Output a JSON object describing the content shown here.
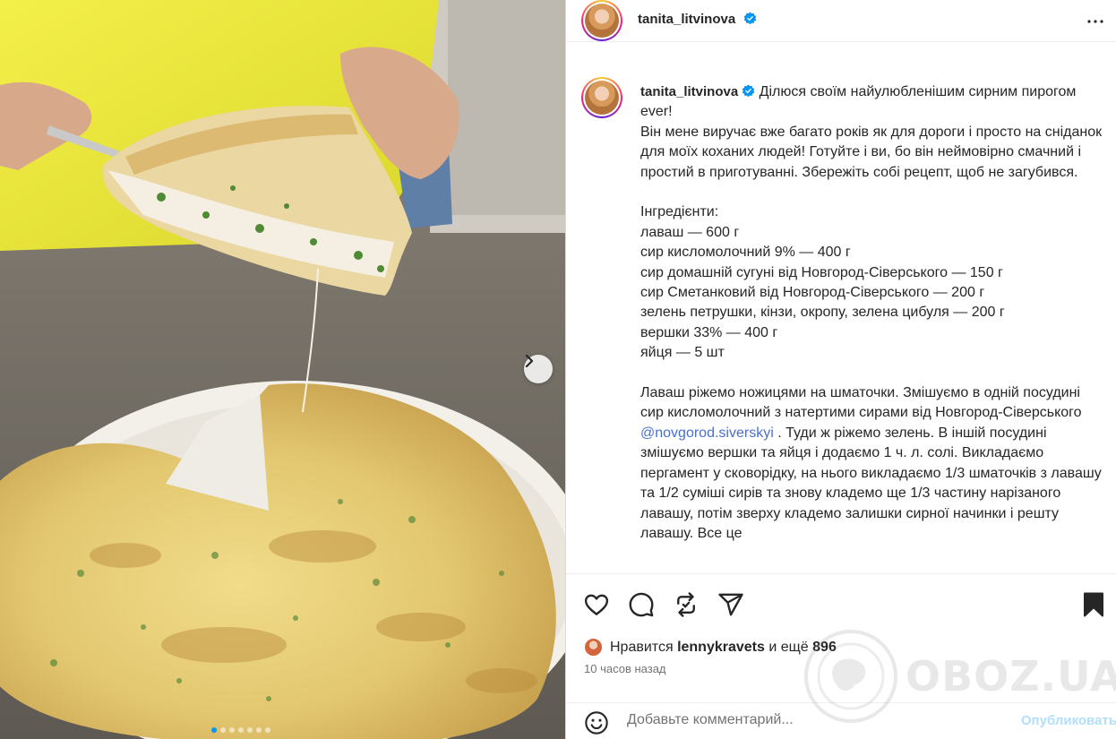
{
  "post": {
    "username": "tanita_litvinova",
    "caption": {
      "intro": "Ділюся своїм найулюбленішим сирним пирогом ever!",
      "paragraph1": "Він мене виручає вже багато років як для дороги і просто на сніданок для моїх коханих людей! Готуйте і ви, бо він неймовірно смачний і простий в приготуванні. Збережіть собі рецепт, щоб не загубився.",
      "ingredients_title": "Інгредієнти:",
      "ingredients": [
        "лаваш — 600 г",
        "сир кисломолочний 9% — 400 г",
        "сир домашній сугуні від Новгород-Сіверського — 150 г",
        "сир Сметанковий від Новгород-Сіверського — 200 г",
        "зелень петрушки, кінзи, окропу, зелена цибуля — 200 г",
        "вершки 33% — 400 г",
        "яйця — 5 шт"
      ],
      "method_part1": "Лаваш ріжемо ножицями на шматочки. Змішуємо в одній посудині сир кисломолочний з натертими сирами від Новгород-Сіверського ",
      "method_mention": "@novgorod.siverskyi",
      "method_part2": " . Туди ж ріжемо зелень. В іншій посудині змішуємо вершки та яйця і додаємо 1 ч. л. солі. Викладаємо пергамент у сковорідку, на нього викладаємо 1/3 шматочків з лавашу та 1/2 суміші сирів та знову кладемо ще 1/3 частину нарізаного лавашу, потім зверху кладемо залишки сирної начинки і решту лавашу. Все це"
    }
  },
  "likes": {
    "prefix": "Нравится ",
    "user": "lennykravets",
    "suffix_and": " и ещё ",
    "count": "896"
  },
  "time_ago": "10 часов назад",
  "comment": {
    "placeholder": "Добавьте комментарий...",
    "publish_label": "Опубликовать"
  },
  "watermark": "OBOZ.UA",
  "carousel": {
    "total": 7,
    "active": 0
  },
  "colors": {
    "verified": "#0095f6",
    "accent": "#0095f6",
    "publish_disabled": "#b2dffc",
    "mention": "#00376b"
  },
  "icons": [
    "more-icon",
    "like-icon",
    "comment-icon",
    "repost-icon",
    "share-icon",
    "save-icon",
    "emoji-icon",
    "verified-icon",
    "next-arrow-icon"
  ]
}
